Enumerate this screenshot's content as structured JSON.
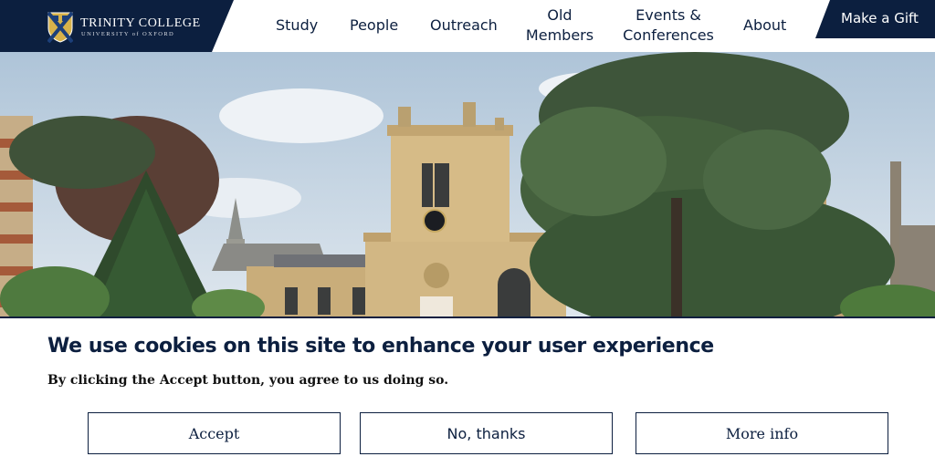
{
  "header": {
    "logo_title": "TRINITY COLLEGE",
    "logo_subtitle": "UNIVERSITY of OXFORD",
    "nav": [
      {
        "line1": "Study",
        "line2": ""
      },
      {
        "line1": "People",
        "line2": ""
      },
      {
        "line1": "Outreach",
        "line2": ""
      },
      {
        "line1": "Old",
        "line2": "Members"
      },
      {
        "line1": "Events &",
        "line2": "Conferences"
      },
      {
        "line1": "About",
        "line2": ""
      }
    ],
    "gift_label": "Make a Gift"
  },
  "hero": {
    "image": "college-building-photo"
  },
  "cookie_banner": {
    "title": "We use cookies on this site to enhance your user experience",
    "text": "By clicking the Accept button, you agree to us doing so.",
    "buttons": {
      "accept": "Accept",
      "decline": "No, thanks",
      "more_info": "More info"
    }
  },
  "colors": {
    "navy": "#0c1f3f",
    "white": "#ffffff",
    "stone": "#c9ad7a"
  }
}
